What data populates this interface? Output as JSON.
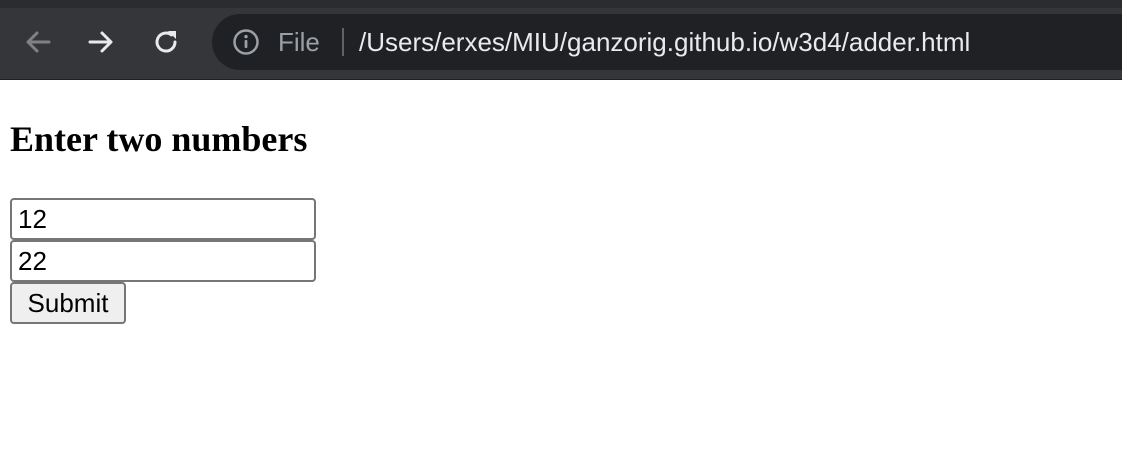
{
  "browser": {
    "nav": {
      "back_icon": "arrow-left-icon",
      "forward_icon": "arrow-right-icon",
      "reload_icon": "reload-icon"
    },
    "omnibox": {
      "info_icon": "info-icon",
      "scheme_label": "File",
      "url": "/Users/erxes/MIU/ganzorig.github.io/w3d4/adder.html"
    },
    "colors": {
      "toolbar_bg": "#35363a",
      "omnibox_bg": "#202124",
      "disabled_icon": "#7f8185",
      "active_icon": "#e8eaed"
    }
  },
  "page": {
    "heading": "Enter two numbers",
    "form": {
      "first_value": "12",
      "second_value": "22",
      "submit_label": "Submit"
    }
  }
}
